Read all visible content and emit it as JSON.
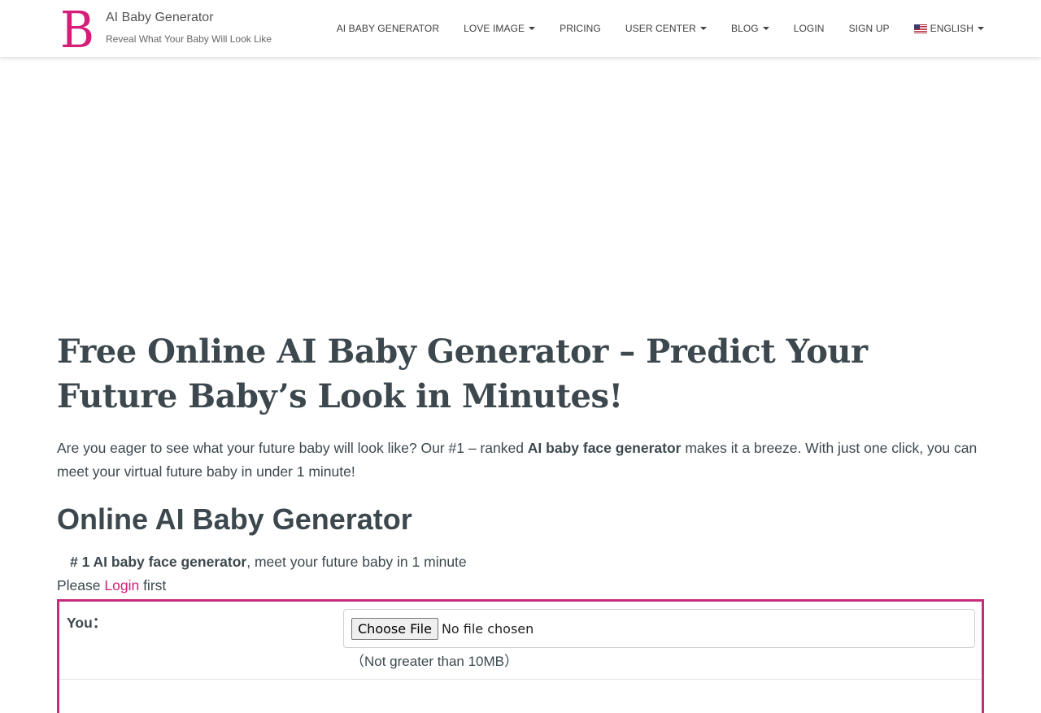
{
  "brand": {
    "logo_letter": "B",
    "title": "AI Baby Generator",
    "tagline": "Reveal What Your Baby Will Look Like"
  },
  "nav": {
    "items": [
      {
        "label": "AI BABY GENERATOR"
      },
      {
        "label": "LOVE IMAGE"
      },
      {
        "label": "PRICING"
      },
      {
        "label": "USER CENTER"
      },
      {
        "label": "BLOG"
      },
      {
        "label": "LOGIN"
      },
      {
        "label": "SIGN UP"
      },
      {
        "label": "ENGLISH"
      }
    ],
    "flag_icon": "us-flag-icon"
  },
  "main": {
    "heading": "Free Online AI Baby Generator – Predict Your Future Baby’s Look in Minutes!",
    "intro_before": "Are you eager to see what your future baby will look like? Our #1 – ranked ",
    "intro_bold": "AI baby face generator",
    "intro_after": " makes it a breeze. With just one click, you can meet your virtual future baby in under 1 minute!",
    "section_title": "Online AI Baby Generator",
    "tagline_bold": "# 1 AI baby face generator",
    "tagline_rest": ", meet your future baby in 1 minute",
    "login_prefix": "Please ",
    "login_link": "Login",
    "login_suffix": " first"
  },
  "upload": {
    "label": "You：",
    "button": "Choose File",
    "status": "No file chosen",
    "note": "（Not greater than 10MB）"
  },
  "colors": {
    "accent": "#d51e78",
    "border": "#c52d7c",
    "text": "#3c484e"
  }
}
